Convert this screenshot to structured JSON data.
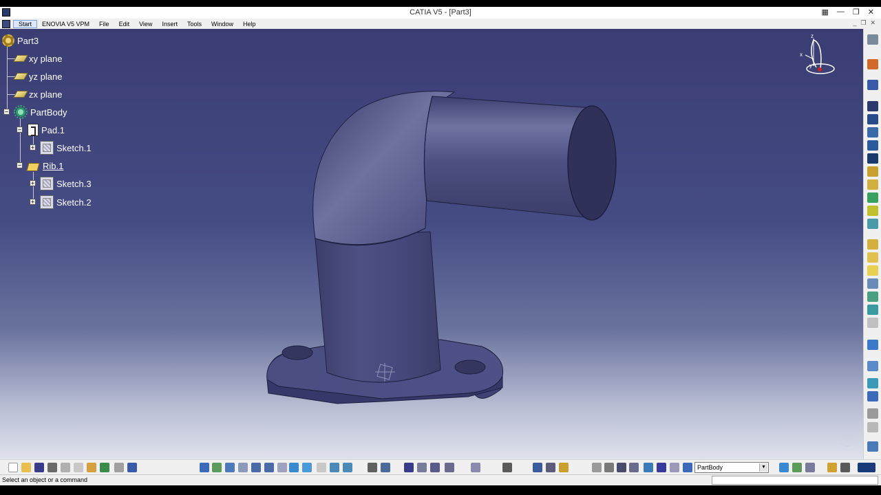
{
  "window": {
    "title": "CATIA V5 - [Part3]"
  },
  "menu": {
    "items": [
      "Start",
      "ENOVIA V5 VPM",
      "File",
      "Edit",
      "View",
      "Insert",
      "Tools",
      "Window",
      "Help"
    ]
  },
  "tree": {
    "root": "Part3",
    "planes": [
      "xy plane",
      "yz plane",
      "zx plane"
    ],
    "body": "PartBody",
    "features": [
      {
        "label": "Pad.1",
        "children": [
          "Sketch.1"
        ]
      },
      {
        "label": "Rib.1",
        "children": [
          "Sketch.3",
          "Sketch.2"
        ]
      }
    ]
  },
  "compass": {
    "x": "x",
    "y": "y",
    "z": "z"
  },
  "toolbar": {
    "current_body": "PartBody"
  },
  "status": {
    "message": "Select an object or a command"
  },
  "colors": {
    "part_color": "#474a7a",
    "background_top": "#3a3d72",
    "background_bottom": "#dfe2ec"
  }
}
